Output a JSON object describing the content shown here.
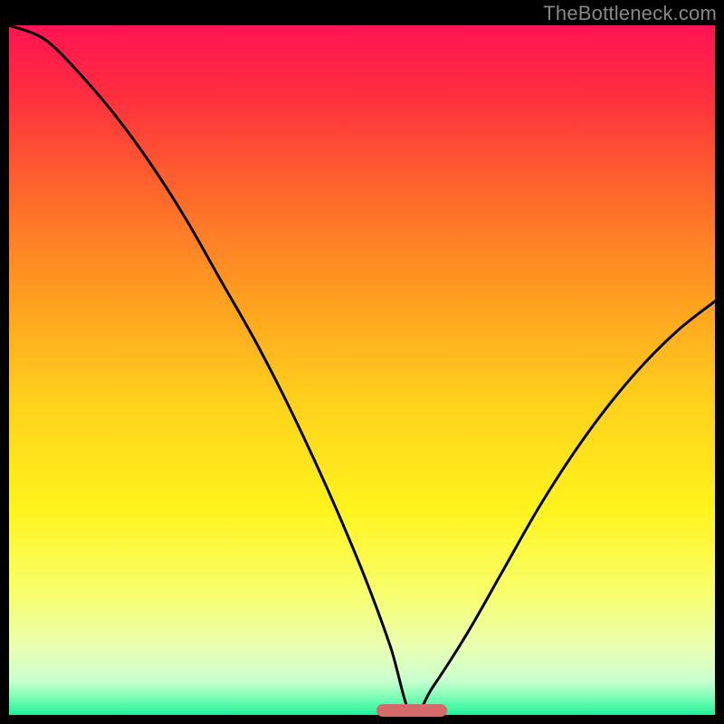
{
  "watermark": "TheBottleneck.com",
  "colors": {
    "black": "#000000",
    "watermark_text": "#888888",
    "marker": "#d66a6a",
    "curve": "#000000",
    "gradient_stops": [
      {
        "offset": 0.0,
        "color": "#ff1452"
      },
      {
        "offset": 0.1,
        "color": "#ff2e3f"
      },
      {
        "offset": 0.25,
        "color": "#ff6a2a"
      },
      {
        "offset": 0.4,
        "color": "#ffa01f"
      },
      {
        "offset": 0.55,
        "color": "#ffd21c"
      },
      {
        "offset": 0.7,
        "color": "#fff31c"
      },
      {
        "offset": 0.82,
        "color": "#f8ff6a"
      },
      {
        "offset": 0.9,
        "color": "#eaffb0"
      },
      {
        "offset": 0.95,
        "color": "#c9ffd0"
      },
      {
        "offset": 0.975,
        "color": "#7affb4"
      },
      {
        "offset": 1.0,
        "color": "#1ef09a"
      }
    ]
  },
  "chart_data": {
    "type": "line",
    "title": "",
    "xlabel": "",
    "ylabel": "",
    "xlim": [
      0,
      100
    ],
    "ylim": [
      0,
      100
    ],
    "grid": false,
    "legend": false,
    "description": "V-shaped bottleneck curve over a vertical heat gradient. Curve descends from top-left, reaches ~0 near x≈57, then rises toward ~60 at the right edge. Lower values are better (green band at bottom).",
    "marker_x_range": [
      52,
      62
    ],
    "series": [
      {
        "name": "bottleneck",
        "x": [
          0,
          5,
          10,
          15,
          20,
          25,
          30,
          35,
          40,
          45,
          50,
          54,
          57,
          60,
          65,
          70,
          75,
          80,
          85,
          90,
          95,
          100
        ],
        "y": [
          100,
          98,
          93,
          87,
          80,
          72,
          63,
          54,
          44,
          33,
          21,
          10,
          0,
          4,
          12,
          21,
          30,
          38,
          45,
          51,
          56,
          60
        ]
      }
    ]
  }
}
